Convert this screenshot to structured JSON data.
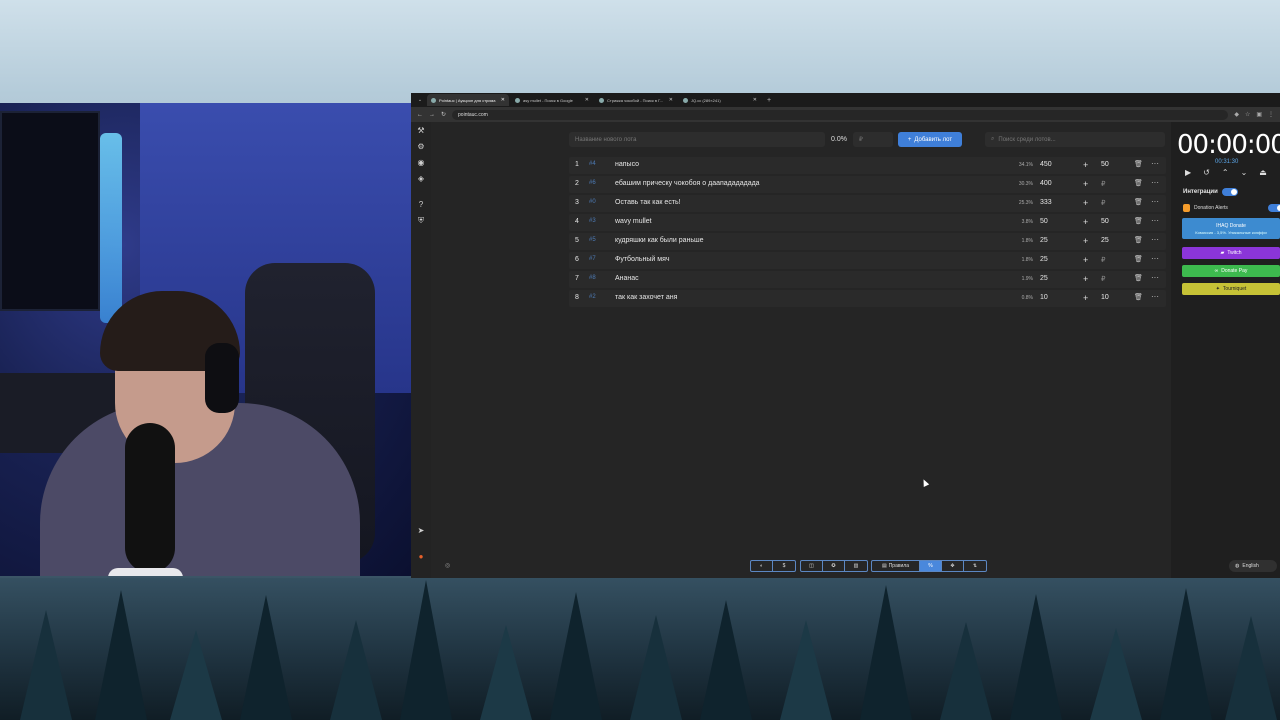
{
  "browser": {
    "tabs": [
      {
        "label": "Pointauc | Аукцион для стрима",
        "active": true
      },
      {
        "label": "asy mullet - Поиск в Google",
        "active": false
      },
      {
        "label": "Стрижка чокобой - Поиск в Г...",
        "active": false
      },
      {
        "label": "JQ.cc (289×241)",
        "active": false
      }
    ],
    "url": "pointauc.com"
  },
  "toolbar": {
    "lot_name_placeholder": "Название нового лота",
    "percent": "0.0%",
    "currency_symbol": "₽",
    "add_button": "Добавить лот",
    "search_placeholder": "Поиск среди лотов..."
  },
  "lots": [
    {
      "index": "1",
      "id": "#4",
      "name": "напысо",
      "percent": "34.1%",
      "amount": "450",
      "add": "50"
    },
    {
      "index": "2",
      "id": "#6",
      "name": "ебашим прическу чокобоя о даападададада",
      "percent": "30.3%",
      "amount": "400",
      "add": "₽"
    },
    {
      "index": "3",
      "id": "#0",
      "name": "Оставь так как есть!",
      "percent": "25.3%",
      "amount": "333",
      "add": "₽"
    },
    {
      "index": "4",
      "id": "#3",
      "name": "wavy mullet",
      "percent": "3.8%",
      "amount": "50",
      "add": "50"
    },
    {
      "index": "5",
      "id": "#5",
      "name": "кудряшки как были раньше",
      "percent": "1.8%",
      "amount": "25",
      "add": "25"
    },
    {
      "index": "6",
      "id": "#7",
      "name": "Футбольный мяч",
      "percent": "1.8%",
      "amount": "25",
      "add": "₽"
    },
    {
      "index": "7",
      "id": "#8",
      "name": "Ананас",
      "percent": "1.9%",
      "amount": "25",
      "add": "₽"
    },
    {
      "index": "8",
      "id": "#2",
      "name": "так как захочет аня",
      "percent": "0.8%",
      "amount": "10",
      "add": "10"
    }
  ],
  "timer": {
    "main": "00:00:00",
    "sub": "00:31:30"
  },
  "integrations": {
    "title": "Интеграции",
    "donation_alerts": "Donation Alerts",
    "ihaq_label": "IHAQ Donate",
    "ihaq_sub": "Комиссия - 3,5%. Уникальные коэффи",
    "twitch": "Twitch",
    "donatepay": "Donate Pay",
    "tourniquet": "Tourniquet"
  },
  "bottom": {
    "rules": "Правила",
    "language": "English"
  },
  "colors": {
    "accent": "#3f7fd9",
    "twitch": "#8b35d9",
    "donatepay": "#3dba4e",
    "tourniquet": "#c6c236",
    "ihaq": "#3d8bd0"
  }
}
